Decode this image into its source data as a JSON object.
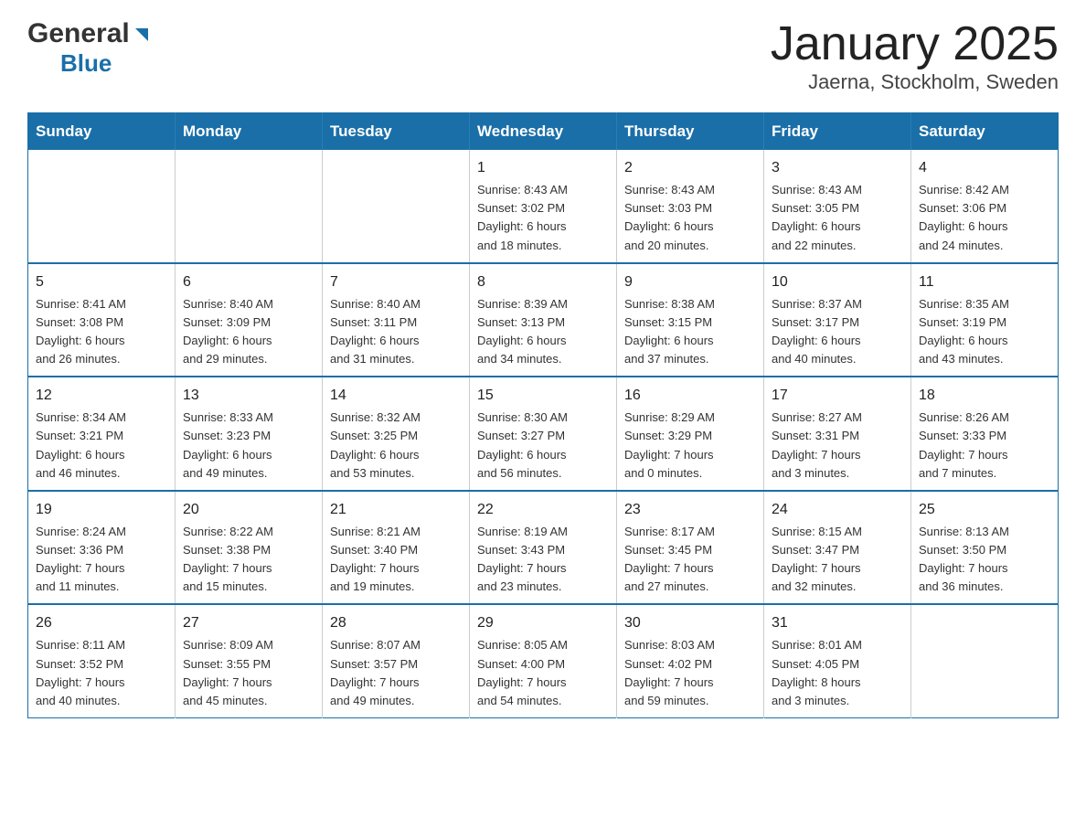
{
  "header": {
    "logo_general": "General",
    "logo_blue": "Blue",
    "title": "January 2025",
    "subtitle": "Jaerna, Stockholm, Sweden"
  },
  "calendar": {
    "days_of_week": [
      "Sunday",
      "Monday",
      "Tuesday",
      "Wednesday",
      "Thursday",
      "Friday",
      "Saturday"
    ],
    "weeks": [
      [
        {
          "day": "",
          "info": ""
        },
        {
          "day": "",
          "info": ""
        },
        {
          "day": "",
          "info": ""
        },
        {
          "day": "1",
          "info": "Sunrise: 8:43 AM\nSunset: 3:02 PM\nDaylight: 6 hours\nand 18 minutes."
        },
        {
          "day": "2",
          "info": "Sunrise: 8:43 AM\nSunset: 3:03 PM\nDaylight: 6 hours\nand 20 minutes."
        },
        {
          "day": "3",
          "info": "Sunrise: 8:43 AM\nSunset: 3:05 PM\nDaylight: 6 hours\nand 22 minutes."
        },
        {
          "day": "4",
          "info": "Sunrise: 8:42 AM\nSunset: 3:06 PM\nDaylight: 6 hours\nand 24 minutes."
        }
      ],
      [
        {
          "day": "5",
          "info": "Sunrise: 8:41 AM\nSunset: 3:08 PM\nDaylight: 6 hours\nand 26 minutes."
        },
        {
          "day": "6",
          "info": "Sunrise: 8:40 AM\nSunset: 3:09 PM\nDaylight: 6 hours\nand 29 minutes."
        },
        {
          "day": "7",
          "info": "Sunrise: 8:40 AM\nSunset: 3:11 PM\nDaylight: 6 hours\nand 31 minutes."
        },
        {
          "day": "8",
          "info": "Sunrise: 8:39 AM\nSunset: 3:13 PM\nDaylight: 6 hours\nand 34 minutes."
        },
        {
          "day": "9",
          "info": "Sunrise: 8:38 AM\nSunset: 3:15 PM\nDaylight: 6 hours\nand 37 minutes."
        },
        {
          "day": "10",
          "info": "Sunrise: 8:37 AM\nSunset: 3:17 PM\nDaylight: 6 hours\nand 40 minutes."
        },
        {
          "day": "11",
          "info": "Sunrise: 8:35 AM\nSunset: 3:19 PM\nDaylight: 6 hours\nand 43 minutes."
        }
      ],
      [
        {
          "day": "12",
          "info": "Sunrise: 8:34 AM\nSunset: 3:21 PM\nDaylight: 6 hours\nand 46 minutes."
        },
        {
          "day": "13",
          "info": "Sunrise: 8:33 AM\nSunset: 3:23 PM\nDaylight: 6 hours\nand 49 minutes."
        },
        {
          "day": "14",
          "info": "Sunrise: 8:32 AM\nSunset: 3:25 PM\nDaylight: 6 hours\nand 53 minutes."
        },
        {
          "day": "15",
          "info": "Sunrise: 8:30 AM\nSunset: 3:27 PM\nDaylight: 6 hours\nand 56 minutes."
        },
        {
          "day": "16",
          "info": "Sunrise: 8:29 AM\nSunset: 3:29 PM\nDaylight: 7 hours\nand 0 minutes."
        },
        {
          "day": "17",
          "info": "Sunrise: 8:27 AM\nSunset: 3:31 PM\nDaylight: 7 hours\nand 3 minutes."
        },
        {
          "day": "18",
          "info": "Sunrise: 8:26 AM\nSunset: 3:33 PM\nDaylight: 7 hours\nand 7 minutes."
        }
      ],
      [
        {
          "day": "19",
          "info": "Sunrise: 8:24 AM\nSunset: 3:36 PM\nDaylight: 7 hours\nand 11 minutes."
        },
        {
          "day": "20",
          "info": "Sunrise: 8:22 AM\nSunset: 3:38 PM\nDaylight: 7 hours\nand 15 minutes."
        },
        {
          "day": "21",
          "info": "Sunrise: 8:21 AM\nSunset: 3:40 PM\nDaylight: 7 hours\nand 19 minutes."
        },
        {
          "day": "22",
          "info": "Sunrise: 8:19 AM\nSunset: 3:43 PM\nDaylight: 7 hours\nand 23 minutes."
        },
        {
          "day": "23",
          "info": "Sunrise: 8:17 AM\nSunset: 3:45 PM\nDaylight: 7 hours\nand 27 minutes."
        },
        {
          "day": "24",
          "info": "Sunrise: 8:15 AM\nSunset: 3:47 PM\nDaylight: 7 hours\nand 32 minutes."
        },
        {
          "day": "25",
          "info": "Sunrise: 8:13 AM\nSunset: 3:50 PM\nDaylight: 7 hours\nand 36 minutes."
        }
      ],
      [
        {
          "day": "26",
          "info": "Sunrise: 8:11 AM\nSunset: 3:52 PM\nDaylight: 7 hours\nand 40 minutes."
        },
        {
          "day": "27",
          "info": "Sunrise: 8:09 AM\nSunset: 3:55 PM\nDaylight: 7 hours\nand 45 minutes."
        },
        {
          "day": "28",
          "info": "Sunrise: 8:07 AM\nSunset: 3:57 PM\nDaylight: 7 hours\nand 49 minutes."
        },
        {
          "day": "29",
          "info": "Sunrise: 8:05 AM\nSunset: 4:00 PM\nDaylight: 7 hours\nand 54 minutes."
        },
        {
          "day": "30",
          "info": "Sunrise: 8:03 AM\nSunset: 4:02 PM\nDaylight: 7 hours\nand 59 minutes."
        },
        {
          "day": "31",
          "info": "Sunrise: 8:01 AM\nSunset: 4:05 PM\nDaylight: 8 hours\nand 3 minutes."
        },
        {
          "day": "",
          "info": ""
        }
      ]
    ]
  }
}
